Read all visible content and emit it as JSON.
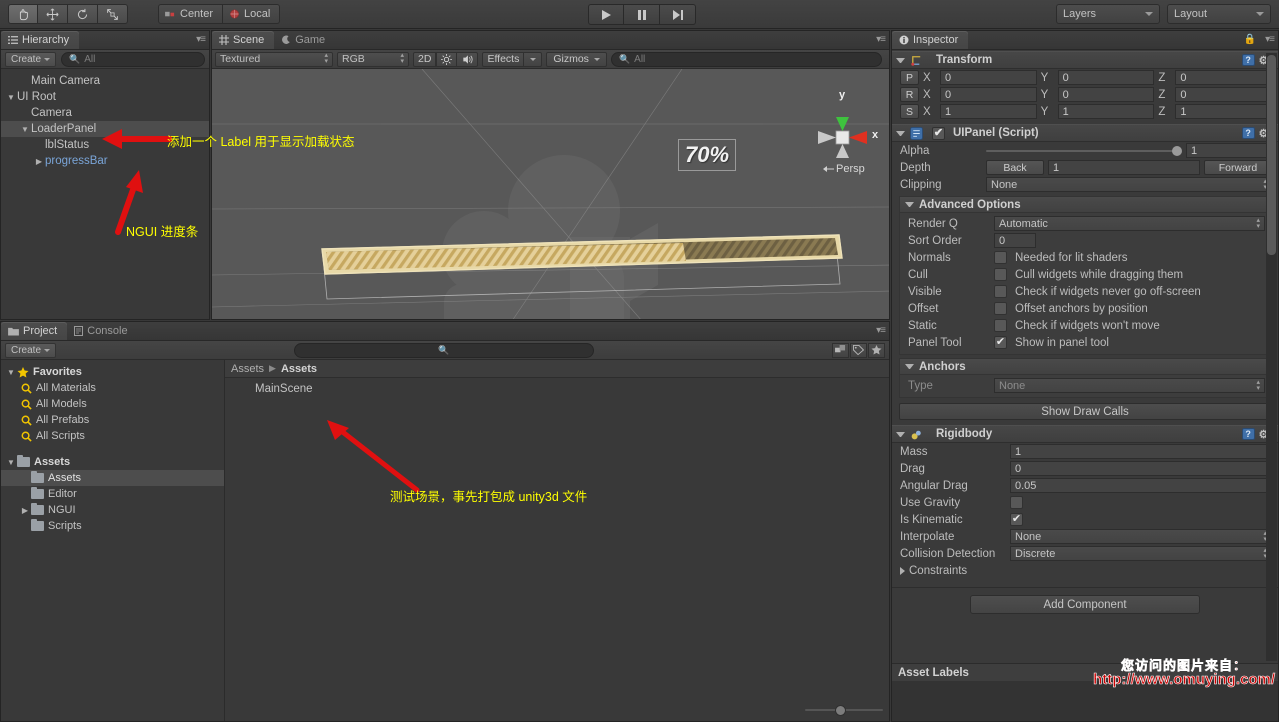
{
  "toolbar": {
    "tools": [
      {
        "name": "hand-tool",
        "glyph": "✋"
      },
      {
        "name": "move-tool",
        "glyph": "✥"
      },
      {
        "name": "rotate-tool",
        "glyph": "↻"
      },
      {
        "name": "scale-tool",
        "glyph": "⤡"
      }
    ],
    "pivot_label": "Center",
    "space_label": "Local",
    "play_label": "▶",
    "pause_label": "❚❚",
    "step_label": "▶❘",
    "layers_label": "Layers",
    "layout_label": "Layout"
  },
  "hierarchy": {
    "tab_label": "Hierarchy",
    "create_label": "Create",
    "search_placeholder": "All",
    "items": [
      {
        "label": "Main Camera",
        "indent": 1,
        "foldout": "none",
        "selected": false,
        "prefab": false
      },
      {
        "label": "UI Root",
        "indent": 0,
        "foldout": "open",
        "selected": false,
        "prefab": false
      },
      {
        "label": "Camera",
        "indent": 1,
        "foldout": "none",
        "selected": false,
        "prefab": false
      },
      {
        "label": "LoaderPanel",
        "indent": 1,
        "foldout": "open",
        "selected": true,
        "prefab": false
      },
      {
        "label": "lblStatus",
        "indent": 2,
        "foldout": "none",
        "selected": false,
        "prefab": false
      },
      {
        "label": "progressBar",
        "indent": 2,
        "foldout": "closed",
        "selected": false,
        "prefab": true
      }
    ]
  },
  "scene": {
    "tab_scene": "Scene",
    "tab_game": "Game",
    "draw_mode": "Textured",
    "color_mode": "RGB",
    "mode_2d": "2D",
    "light_glyph": "☀",
    "audio_glyph": "◀))",
    "effects_label": "Effects",
    "gizmos_label": "Gizmos",
    "search_placeholder": "All",
    "progress_text": "70%",
    "progress_value": 70,
    "gizmo": {
      "x_label": "x",
      "y_label": "y",
      "persp_label": "Persp"
    }
  },
  "project": {
    "tab_project": "Project",
    "tab_console": "Console",
    "create_label": "Create",
    "search_placeholder": "",
    "favorites_label": "Favorites",
    "favorites": [
      "All Materials",
      "All Models",
      "All Prefabs",
      "All Scripts"
    ],
    "assets_label": "Assets",
    "folders": [
      {
        "label": "Assets",
        "foldout": "none",
        "selected": true
      },
      {
        "label": "Editor",
        "foldout": "none",
        "selected": false
      },
      {
        "label": "NGUI",
        "foldout": "closed",
        "selected": false
      },
      {
        "label": "Scripts",
        "foldout": "none",
        "selected": false
      }
    ],
    "breadcrumb": [
      "Assets",
      "Assets"
    ],
    "content_items": [
      "MainScene"
    ]
  },
  "inspector": {
    "tab_label": "Inspector",
    "transform": {
      "title": "Transform",
      "rows": [
        {
          "key": "P",
          "x_label": "X",
          "x": "0",
          "y_label": "Y",
          "y": "0",
          "z_label": "Z",
          "z": "0"
        },
        {
          "key": "R",
          "x_label": "X",
          "x": "0",
          "y_label": "Y",
          "y": "0",
          "z_label": "Z",
          "z": "0"
        },
        {
          "key": "S",
          "x_label": "X",
          "x": "1",
          "y_label": "Y",
          "y": "1",
          "z_label": "Z",
          "z": "1"
        }
      ]
    },
    "uipanel": {
      "title": "UIPanel (Script)",
      "enabled": true,
      "alpha_label": "Alpha",
      "alpha_value": "1",
      "depth_label": "Depth",
      "depth_back": "Back",
      "depth_value": "1",
      "depth_forward": "Forward",
      "clipping_label": "Clipping",
      "clipping_value": "None",
      "advanced_label": "Advanced Options",
      "render_q_label": "Render Q",
      "render_q_value": "Automatic",
      "sort_order_label": "Sort Order",
      "sort_order_value": "0",
      "toggles": [
        {
          "label": "Normals",
          "text": "Needed for lit shaders",
          "checked": false
        },
        {
          "label": "Cull",
          "text": "Cull widgets while dragging them",
          "checked": false
        },
        {
          "label": "Visible",
          "text": "Check if widgets never go off-screen",
          "checked": false
        },
        {
          "label": "Offset",
          "text": "Offset anchors by position",
          "checked": false
        },
        {
          "label": "Static",
          "text": "Check if widgets won't move",
          "checked": false
        },
        {
          "label": "Panel Tool",
          "text": "Show in panel tool",
          "checked": true
        }
      ],
      "anchors_label": "Anchors",
      "anchor_type_label": "Type",
      "anchor_type_value": "None",
      "draw_calls_label": "Show Draw Calls"
    },
    "rigidbody": {
      "title": "Rigidbody",
      "mass_label": "Mass",
      "mass_value": "1",
      "drag_label": "Drag",
      "drag_value": "0",
      "angular_drag_label": "Angular Drag",
      "angular_drag_value": "0.05",
      "use_gravity_label": "Use Gravity",
      "use_gravity": false,
      "is_kinematic_label": "Is Kinematic",
      "is_kinematic": true,
      "interpolate_label": "Interpolate",
      "interpolate_value": "None",
      "collision_label": "Collision Detection",
      "collision_value": "Discrete",
      "constraints_label": "Constraints"
    },
    "add_component_label": "Add Component",
    "asset_labels_title": "Asset Labels"
  },
  "annotations": [
    {
      "name": "annotation-label-note",
      "text": "添加一个 Label 用于显示加载状态"
    },
    {
      "name": "annotation-progressbar-note",
      "text": "NGUI 进度条"
    },
    {
      "name": "annotation-scene-note",
      "text": "测试场景，事先打包成 unity3d 文件"
    }
  ],
  "watermark": {
    "line1": "您访问的图片来自：",
    "line2": "http://www.omuying.com/"
  },
  "colors": {
    "annotation": "#ffff00",
    "watermark": "#cc0000",
    "prefab_blue": "#7aa5d8",
    "progress_fill": "#e8d5a0",
    "gizmo_x": "#e02020",
    "gizmo_y": "#30c030"
  }
}
